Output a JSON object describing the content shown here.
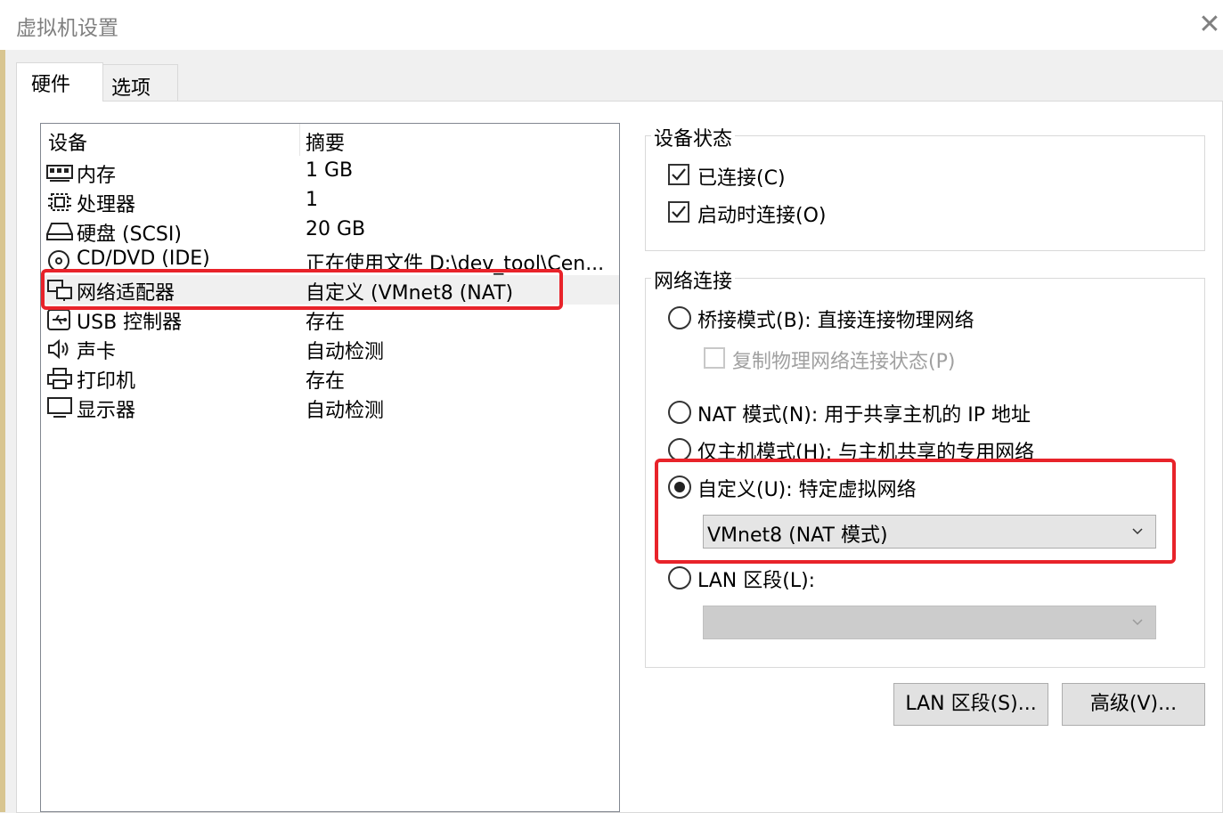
{
  "window": {
    "title": "虚拟机设置",
    "close_glyph": "✕"
  },
  "tabs": [
    {
      "label": "硬件",
      "active": true
    },
    {
      "label": "选项",
      "active": false
    }
  ],
  "device_list": {
    "headers": {
      "device": "设备",
      "summary": "摘要"
    },
    "rows": [
      {
        "name": "内存",
        "summary": "1 GB",
        "icon": "memory-icon"
      },
      {
        "name": "处理器",
        "summary": "1",
        "icon": "cpu-icon"
      },
      {
        "name": "硬盘 (SCSI)",
        "summary": "20 GB",
        "icon": "hard-disk-icon"
      },
      {
        "name": "CD/DVD (IDE)",
        "summary": "正在使用文件 D:\\dev_tool\\Cen...",
        "icon": "cd-dvd-icon"
      },
      {
        "name": "网络适配器",
        "summary": "自定义 (VMnet8 (NAT)",
        "icon": "network-adapter-icon",
        "selected": true
      },
      {
        "name": "USB 控制器",
        "summary": "存在",
        "icon": "usb-icon"
      },
      {
        "name": "声卡",
        "summary": "自动检测",
        "icon": "speaker-icon"
      },
      {
        "name": "打印机",
        "summary": "存在",
        "icon": "printer-icon"
      },
      {
        "name": "显示器",
        "summary": "自动检测",
        "icon": "monitor-icon"
      }
    ]
  },
  "device_status": {
    "title": "设备状态",
    "connected": {
      "label": "已连接(C)",
      "checked": true
    },
    "connect_at_power_on": {
      "label": "启动时连接(O)",
      "checked": true
    }
  },
  "network": {
    "title": "网络连接",
    "bridged": {
      "label": "桥接模式(B): 直接连接物理网络",
      "selected": false
    },
    "replicate": {
      "label": "复制物理网络连接状态(P)",
      "checked": false,
      "disabled": true
    },
    "nat": {
      "label": "NAT 模式(N): 用于共享主机的 IP 地址",
      "selected": false
    },
    "host_only": {
      "label": "仅主机模式(H): 与主机共享的专用网络",
      "selected": false
    },
    "custom": {
      "label": "自定义(U): 特定虚拟网络",
      "selected": true,
      "value": "VMnet8 (NAT 模式)"
    },
    "lan_segment": {
      "label": "LAN 区段(L):",
      "selected": false,
      "value": ""
    }
  },
  "buttons": {
    "lan_segments": "LAN 区段(S)...",
    "advanced": "高级(V)..."
  },
  "colors": {
    "highlight": "#e8232a"
  }
}
